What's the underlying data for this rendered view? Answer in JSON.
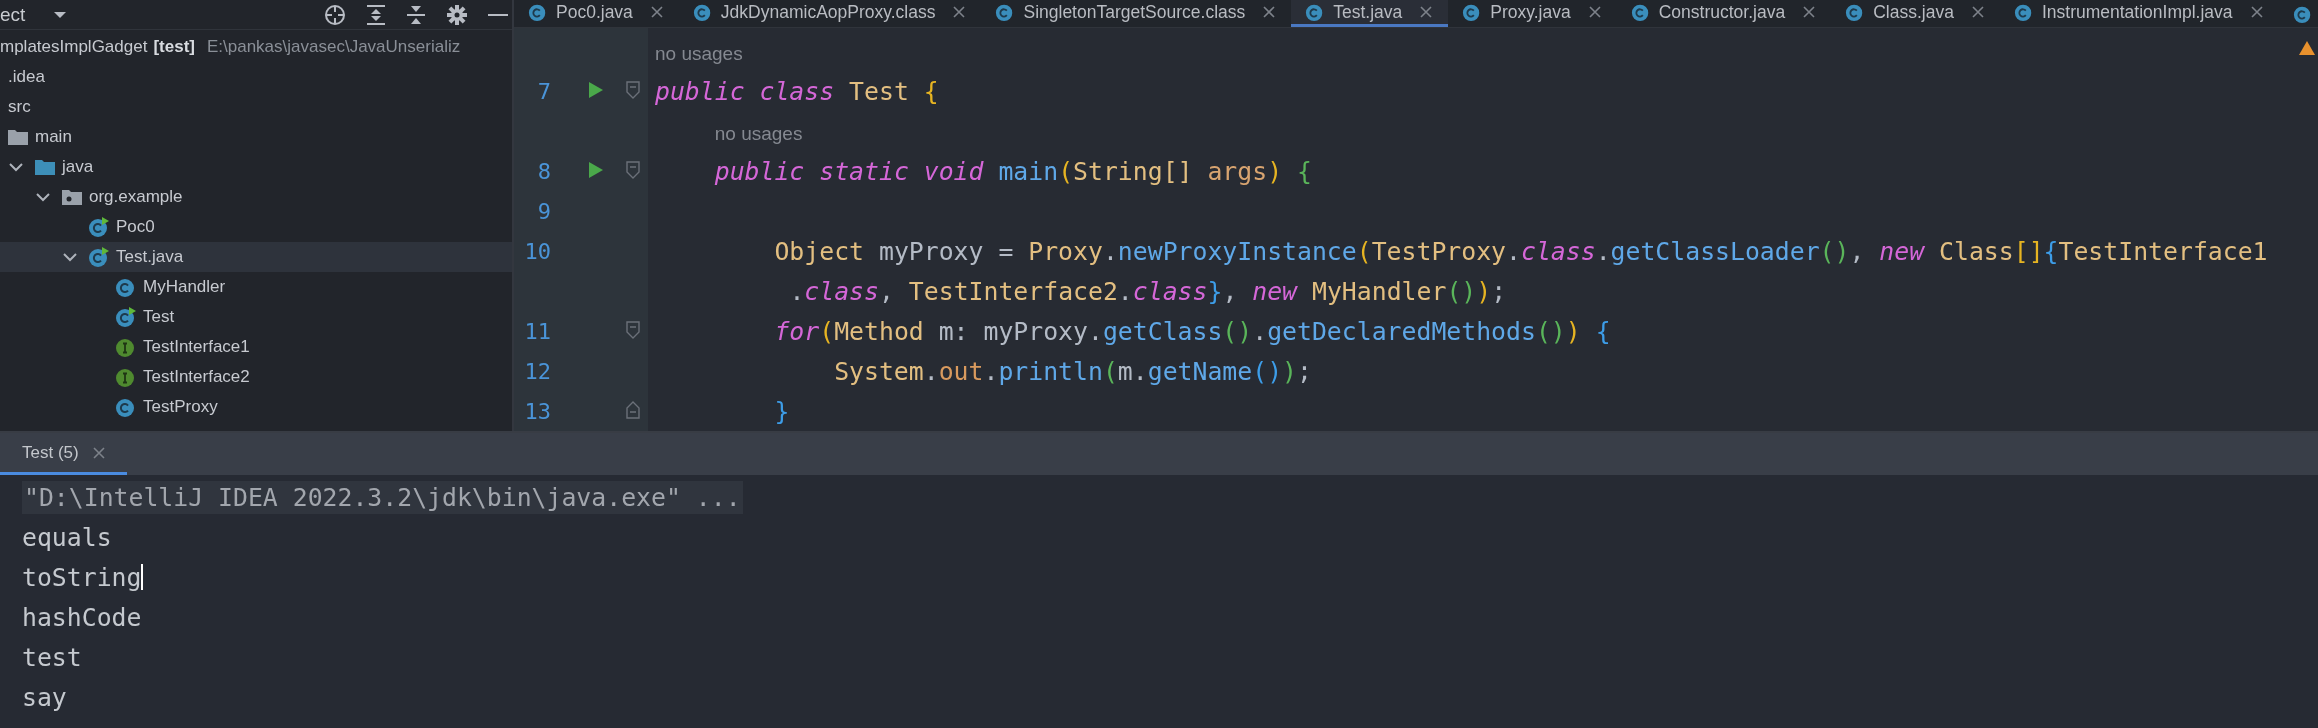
{
  "project": {
    "header": {
      "title": "ect"
    },
    "root": {
      "name": "mplatesImplGadget",
      "module": "[test]",
      "path": "E:\\pankas\\javasec\\JavaUnserializ"
    },
    "tree": [
      {
        "name": ".idea",
        "selected": false
      },
      {
        "name": "src",
        "selected": false,
        "children": [
          {
            "name": "main",
            "kind": "folder",
            "selected": false,
            "children": [
              {
                "name": "java",
                "kind": "source",
                "expanded": true,
                "selected": false,
                "children": [
                  {
                    "name": "org.example",
                    "kind": "package",
                    "expanded": true,
                    "selected": false,
                    "children": [
                      {
                        "name": "Poc0",
                        "kind": "main",
                        "selected": false
                      },
                      {
                        "name": "Test.java",
                        "kind": "main",
                        "expanded": true,
                        "selected": true,
                        "children": [
                          {
                            "name": "MyHandler",
                            "kind": "class",
                            "selected": false
                          },
                          {
                            "name": "Test",
                            "kind": "main",
                            "selected": false
                          },
                          {
                            "name": "TestInterface1",
                            "kind": "interface",
                            "selected": false
                          },
                          {
                            "name": "TestInterface2",
                            "kind": "interface",
                            "selected": false
                          },
                          {
                            "name": "TestProxy",
                            "kind": "class",
                            "selected": false
                          }
                        ]
                      }
                    ]
                  }
                ]
              }
            ]
          }
        ]
      }
    ]
  },
  "editor": {
    "tabs": [
      {
        "label": "Poc0.java",
        "selected": false
      },
      {
        "label": "JdkDynamicAopProxy.class",
        "selected": false
      },
      {
        "label": "SingletonTargetSource.class",
        "selected": false
      },
      {
        "label": "Test.java",
        "selected": true
      },
      {
        "label": "Proxy.java",
        "selected": false
      },
      {
        "label": "Constructor.java",
        "selected": false
      },
      {
        "label": "Class.java",
        "selected": false
      },
      {
        "label": "InstrumentationImpl.java",
        "selected": false
      }
    ],
    "overflow_tab": true,
    "warning": true,
    "lines": [
      {
        "kind": "hint",
        "text": "no usages"
      },
      {
        "kind": "code",
        "number": "7",
        "run": true,
        "fold_open": true,
        "fold_close": false,
        "tokens": [
          {
            "text": "public",
            "kind": "kw"
          },
          {
            "text": " class",
            "kind": "kw"
          },
          {
            "text": " Test",
            "kind": "type"
          },
          {
            "text": " {",
            "kind": "b1"
          }
        ]
      },
      {
        "kind": "hint",
        "text": "    no usages"
      },
      {
        "kind": "code",
        "number": "8",
        "run": true,
        "fold_open": true,
        "fold_close": false,
        "tokens": [
          {
            "text": "    public",
            "kind": "kw"
          },
          {
            "text": " static",
            "kind": "kw"
          },
          {
            "text": " void",
            "kind": "kw"
          },
          {
            "text": " main",
            "kind": "method"
          },
          {
            "text": "(",
            "kind": "b1"
          },
          {
            "text": "String[]",
            "kind": "type"
          },
          {
            "text": " args",
            "kind": "param"
          },
          {
            "text": ")",
            "kind": "b1"
          },
          {
            "text": " {",
            "kind": "b2"
          }
        ]
      },
      {
        "kind": "code",
        "number": "9",
        "run": false,
        "fold_open": false,
        "fold_close": false
      },
      {
        "kind": "code",
        "number": "10",
        "run": false,
        "fold_open": false,
        "fold_close": false,
        "tokens": [
          {
            "text": "        Object",
            "kind": "type"
          },
          {
            "text": " myProxy =",
            "kind": "plain"
          },
          {
            "text": " Proxy",
            "kind": "type"
          },
          {
            "text": ".",
            "kind": "plain"
          },
          {
            "text": "newProxyInstance",
            "kind": "method"
          },
          {
            "text": "(",
            "kind": "b1"
          },
          {
            "text": "TestProxy",
            "kind": "type"
          },
          {
            "text": ".",
            "kind": "plain"
          },
          {
            "text": "class",
            "kind": "kw"
          },
          {
            "text": ".",
            "kind": "plain"
          },
          {
            "text": "getClassLoader",
            "kind": "method"
          },
          {
            "text": "()",
            "kind": "b2"
          },
          {
            "text": ",",
            "kind": "plain"
          },
          {
            "text": " new",
            "kind": "kw"
          },
          {
            "text": " Class",
            "kind": "type"
          },
          {
            "text": "[]",
            "kind": "b1"
          },
          {
            "text": "{",
            "kind": "b3"
          },
          {
            "text": "TestInterface1",
            "kind": "type"
          }
        ],
        "wrap": [
          {
            "text": "         .",
            "kind": "plain"
          },
          {
            "text": "class",
            "kind": "kw"
          },
          {
            "text": ",",
            "kind": "plain"
          },
          {
            "text": " TestInterface2",
            "kind": "type"
          },
          {
            "text": ".",
            "kind": "plain"
          },
          {
            "text": "class",
            "kind": "kw"
          },
          {
            "text": "}",
            "kind": "b3"
          },
          {
            "text": ",",
            "kind": "plain"
          },
          {
            "text": " new",
            "kind": "kw"
          },
          {
            "text": " MyHandler",
            "kind": "type"
          },
          {
            "text": "()",
            "kind": "b2"
          },
          {
            "text": ")",
            "kind": "b1"
          },
          {
            "text": ";",
            "kind": "plain"
          }
        ]
      },
      {
        "kind": "code",
        "number": "11",
        "run": false,
        "fold_open": true,
        "fold_close": false,
        "tokens": [
          {
            "text": "        for",
            "kind": "kw"
          },
          {
            "text": "(",
            "kind": "b1"
          },
          {
            "text": "Method",
            "kind": "type"
          },
          {
            "text": " m: myProxy.",
            "kind": "plain"
          },
          {
            "text": "getClass",
            "kind": "method"
          },
          {
            "text": "()",
            "kind": "b2"
          },
          {
            "text": ".",
            "kind": "plain"
          },
          {
            "text": "getDeclaredMethods",
            "kind": "method"
          },
          {
            "text": "()",
            "kind": "b2"
          },
          {
            "text": ")",
            "kind": "b1"
          },
          {
            "text": " {",
            "kind": "b3"
          }
        ]
      },
      {
        "kind": "code",
        "number": "12",
        "run": false,
        "fold_open": false,
        "fold_close": false,
        "tokens": [
          {
            "text": "            System",
            "kind": "type"
          },
          {
            "text": ".",
            "kind": "plain"
          },
          {
            "text": "out",
            "kind": "field"
          },
          {
            "text": ".",
            "kind": "plain"
          },
          {
            "text": "println",
            "kind": "method"
          },
          {
            "text": "(",
            "kind": "b2"
          },
          {
            "text": "m.",
            "kind": "plain"
          },
          {
            "text": "getName",
            "kind": "method"
          },
          {
            "text": "()",
            "kind": "b3"
          },
          {
            "text": ")",
            "kind": "b2"
          },
          {
            "text": ";",
            "kind": "plain"
          }
        ]
      },
      {
        "kind": "code",
        "number": "13",
        "run": false,
        "fold_open": false,
        "fold_close": true,
        "tokens": [
          {
            "text": "        }",
            "kind": "b3"
          }
        ]
      }
    ]
  },
  "run_panel": {
    "tab": {
      "label": "Test (5)",
      "selected": true
    },
    "console": [
      {
        "kind": "command",
        "text": "\"D:\\IntelliJ IDEA 2022.3.2\\jdk\\bin\\java.exe\" ...",
        "caret": false
      },
      {
        "kind": "output",
        "text": "equals",
        "caret": false
      },
      {
        "kind": "output",
        "text": "toString",
        "caret": true
      },
      {
        "kind": "output",
        "text": "hashCode",
        "caret": false
      },
      {
        "kind": "output",
        "text": "test",
        "caret": false
      },
      {
        "kind": "output",
        "text": "say",
        "caret": false
      }
    ]
  }
}
